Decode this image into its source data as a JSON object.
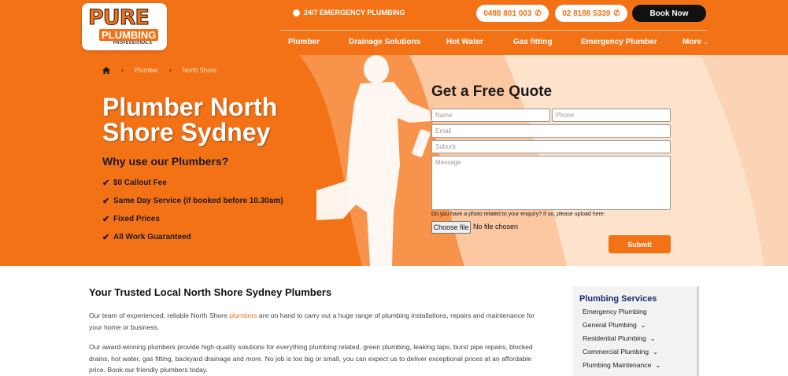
{
  "header": {
    "logo": {
      "main": "PURE",
      "sub": "PLUMBING",
      "tag": "PROFESSIONALS"
    },
    "emergency": "24/7 EMERGENCY PLUMBING",
    "phone1": "0488 801 003",
    "phone2": "02 8188 5339",
    "book": "Book Now",
    "nav": [
      "Plumber",
      "Drainage Solutions",
      "Hot Water",
      "Gas fitting",
      "Emergency Plumber",
      "More"
    ]
  },
  "breadcrumb": [
    "Plumber",
    "North Shore"
  ],
  "hero": {
    "title": "Plumber North Shore Sydney",
    "why": "Why use our Plumbers?",
    "points": [
      "$0 Callout Fee",
      "Same Day Service (if booked before 10.30am)",
      "Fixed Prices",
      "All Work Guaranteed"
    ]
  },
  "form": {
    "title": "Get a Free Quote",
    "name_ph": "Name",
    "phone_ph": "Phone",
    "email_ph": "Email",
    "suburb_ph": "Suburb",
    "message_ph": "Message",
    "upload_label": "Do you have a photo related to your enquiry? If so, please upload here:",
    "choose_file": "Choose file",
    "no_file": "No file chosen",
    "submit": "Submit"
  },
  "content": {
    "heading": "Your Trusted Local North Shore Sydney Plumbers",
    "p1_a": "Our team of experienced, reliable North Shore ",
    "p1_link": "plumbers",
    "p1_b": " are on hand to carry out a huge range of plumbing installations, repairs and maintenance for your home or business.",
    "p2": "Our award-winning plumbers provide high-quality solutions for everything plumbing related, green plumbing, leaking taps, burst pipe repairs, blocked drains, hot water, gas fitting, backyard drainage and more. No job is too big or small, you can expect us to deliver exceptional prices at an affordable price. Book our friendly plumbers today."
  },
  "sidebar": {
    "title": "Plumbing Services",
    "items": [
      "Emergency Plumbing",
      "General Plumbing",
      "Residential Plumbing",
      "Commercial Plumbing",
      "Plumbing Maintenance"
    ]
  },
  "colors": {
    "brand": "#f47216",
    "dark": "#111111",
    "sidebar_title": "#1a2a6c"
  }
}
